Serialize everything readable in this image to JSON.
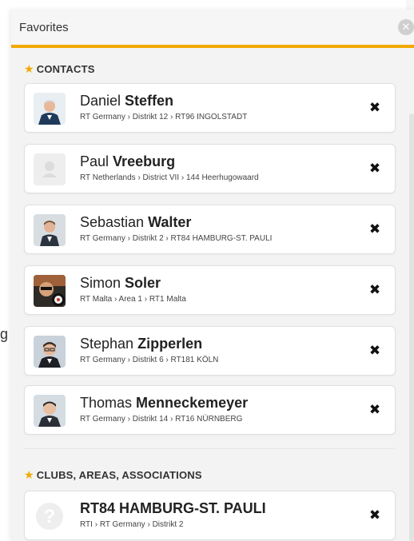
{
  "background_text": "g",
  "panel": {
    "title": "Favorites",
    "close_icon": "close-circle-icon",
    "accent_color": "#f2a900"
  },
  "sections": {
    "contacts": {
      "title": "CONTACTS",
      "icon": "star-icon"
    },
    "clubs": {
      "title": "CLUBS, AREAS, ASSOCIATIONS",
      "icon": "star-icon"
    }
  },
  "contacts": [
    {
      "first": "Daniel",
      "last": "Steffen",
      "path": "RT Germany › Distrikt 12 › RT96 INGOLSTADT",
      "avatar": "portrait-photo"
    },
    {
      "first": "Paul",
      "last": "Vreeburg",
      "path": "RT Netherlands › District VII › 144 Heerhugowaard",
      "avatar": "placeholder-avatar"
    },
    {
      "first": "Sebastian",
      "last": "Walter",
      "path": "RT Germany › Distrikt 2 › RT84 HAMBURG-ST. PAULI",
      "avatar": "portrait-photo"
    },
    {
      "first": "Simon",
      "last": "Soler",
      "path": "RT Malta › Area 1 › RT1 Malta",
      "avatar": "darts-photo"
    },
    {
      "first": "Stephan",
      "last": "Zipperlen",
      "path": "RT Germany › Distrikt 6 › RT181 KÖLN",
      "avatar": "portrait-photo"
    },
    {
      "first": "Thomas",
      "last": "Menneckemeyer",
      "path": "RT Germany › Distrikt 14 › RT16 NÜRNBERG",
      "avatar": "portrait-photo"
    }
  ],
  "clubs": [
    {
      "name": "RT84 HAMBURG-ST. PAULI",
      "path": "RTI › RT Germany › Distrikt 2",
      "avatar": "question-mark-icon"
    }
  ],
  "remove_icon": "✖"
}
